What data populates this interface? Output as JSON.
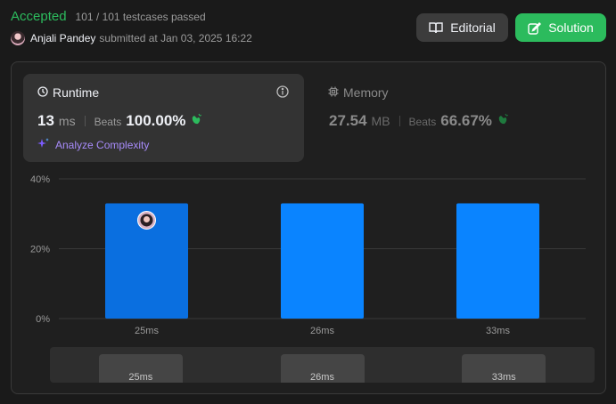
{
  "submission": {
    "status": "Accepted",
    "testcases": "101 / 101 testcases passed",
    "username": "Anjali Pandey",
    "submitted_at": "submitted at Jan 03, 2025 16:22"
  },
  "actions": {
    "editorial_label": "Editorial",
    "solution_label": "Solution"
  },
  "runtime": {
    "title": "Runtime",
    "value": "13",
    "unit": "ms",
    "beats_label": "Beats",
    "beats_value": "100.00%",
    "analyze_label": "Analyze Complexity"
  },
  "memory": {
    "title": "Memory",
    "value": "27.54",
    "unit": "MB",
    "beats_label": "Beats",
    "beats_value": "66.67%"
  },
  "colors": {
    "accepted": "#2cbb5d",
    "bar": "#0a84ff",
    "bar_selected": "#0a6fe0",
    "accent": "#a78bfa"
  },
  "chart_data": {
    "type": "bar",
    "categories": [
      "25ms",
      "26ms",
      "33ms"
    ],
    "values": [
      33,
      33,
      33
    ],
    "selected_index": 0,
    "ylim": [
      0,
      40
    ],
    "yticks": [
      "0%",
      "20%",
      "40%"
    ],
    "grid": true
  },
  "navigator": {
    "labels": [
      "25ms",
      "26ms",
      "33ms"
    ]
  }
}
